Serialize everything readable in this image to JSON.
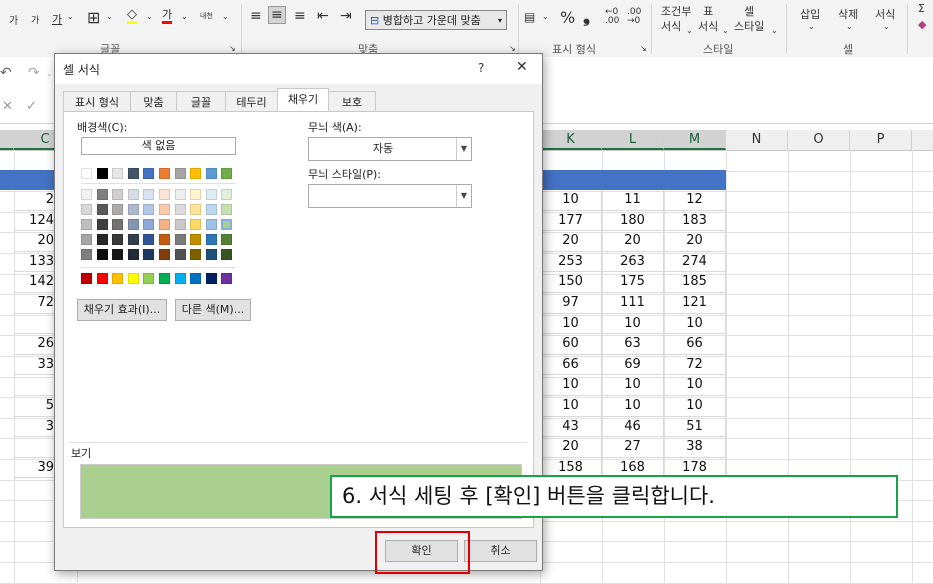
{
  "ribbon": {
    "font_group_label": "글꼴",
    "align_group_label": "맞춤",
    "number_group_label": "표시 형식",
    "style_group_label": "스타일",
    "cells_group_label": "셀",
    "merge_center_label": "병합하고 가운데 맞춤",
    "percent_symbol": "%",
    "comma_symbol": "❟",
    "conditional_format_label": "조건부\n서식",
    "format_table_label": "표\n서식",
    "cell_style_label": "셀\n스타일",
    "insert_label": "삽입",
    "delete_label": "삭제",
    "format_label": "서식",
    "small_a1": "가",
    "small_a2": "가",
    "underline_ga": "가",
    "font_color_ga": "가",
    "phonetic_label": "내천"
  },
  "sheet": {
    "columns": [
      "C",
      "K",
      "L",
      "M",
      "N",
      "O",
      "P"
    ],
    "partial_col_values": [
      "2",
      "124",
      "20",
      "133",
      "142",
      "72",
      "",
      "26",
      "33",
      "",
      "5",
      "3",
      "",
      "39"
    ],
    "rows": [
      [
        "10",
        "11",
        "12"
      ],
      [
        "177",
        "180",
        "183"
      ],
      [
        "20",
        "20",
        "20"
      ],
      [
        "253",
        "263",
        "274"
      ],
      [
        "150",
        "175",
        "185"
      ],
      [
        "97",
        "111",
        "121"
      ],
      [
        "10",
        "10",
        "10"
      ],
      [
        "60",
        "63",
        "66"
      ],
      [
        "66",
        "69",
        "72"
      ],
      [
        "10",
        "10",
        "10"
      ],
      [
        "10",
        "10",
        "10"
      ],
      [
        "43",
        "46",
        "51"
      ],
      [
        "20",
        "27",
        "38"
      ],
      [
        "158",
        "168",
        "178"
      ]
    ]
  },
  "dialog": {
    "title": "셀 서식",
    "help": "?",
    "close": "✕",
    "tabs": [
      "표시 형식",
      "맞춤",
      "글꼴",
      "테두리",
      "채우기",
      "보호"
    ],
    "background_color_label": "배경색(C):",
    "no_color_label": "색 없음",
    "pattern_color_label": "무늬 색(A):",
    "pattern_color_value": "자동",
    "pattern_style_label": "무늬 스타일(P):",
    "fill_effects_button": "채우기 효과(I)...",
    "more_colors_button": "다른 색(M)...",
    "sample_label": "보기",
    "sample_color": "#a9d08e",
    "ok_button": "확인",
    "cancel_button": "취소"
  },
  "palette": {
    "theme_top": [
      "#ffffff",
      "#000000",
      "#e7e6e6",
      "#44546a",
      "#4472c4",
      "#ed7d31",
      "#a5a5a5",
      "#ffc000",
      "#5b9bd5",
      "#70ad47"
    ],
    "theme_shades": [
      [
        "#f2f2f2",
        "#7f7f7f",
        "#d0cece",
        "#d6dce4",
        "#d9e2f3",
        "#fbe4d5",
        "#ededed",
        "#fff2cc",
        "#deebf6",
        "#e2efd9"
      ],
      [
        "#d8d8d8",
        "#595959",
        "#aeaaaa",
        "#adb9ca",
        "#b4c6e7",
        "#f7cbac",
        "#dbdbdb",
        "#fee599",
        "#bdd7ee",
        "#c5e0b3"
      ],
      [
        "#bfbfbf",
        "#3f3f3f",
        "#757070",
        "#8496b0",
        "#8eaadb",
        "#f4b183",
        "#c9c9c9",
        "#ffd965",
        "#9cc3e5",
        "#a8d08d"
      ],
      [
        "#a5a5a5",
        "#262626",
        "#3a3838",
        "#323f4f",
        "#2f5496",
        "#c55a11",
        "#7b7b7b",
        "#bf9000",
        "#2e75b5",
        "#538135"
      ],
      [
        "#7f7f7f",
        "#0c0c0c",
        "#171616",
        "#222a35",
        "#1f3864",
        "#833c0b",
        "#525252",
        "#7f6000",
        "#1e4e79",
        "#375623"
      ]
    ],
    "standard": [
      "#c00000",
      "#ff0000",
      "#ffc000",
      "#ffff00",
      "#92d050",
      "#00b050",
      "#00b0f0",
      "#0070c0",
      "#002060",
      "#7030a0"
    ]
  },
  "callout": {
    "text": "6. 서식 세팅 후 [확인] 버튼을 클릭합니다."
  }
}
